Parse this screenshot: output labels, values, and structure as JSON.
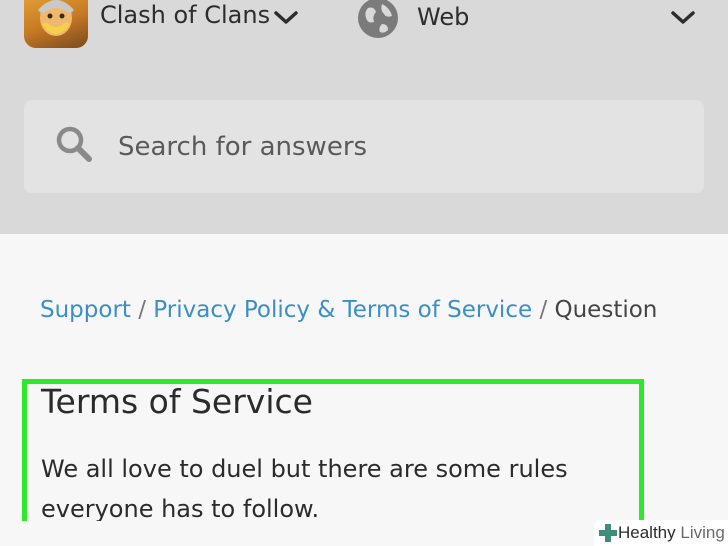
{
  "header": {
    "app_name": "Clash of Clans",
    "platform": "Web"
  },
  "search": {
    "placeholder": "Search for answers"
  },
  "breadcrumb": {
    "items": [
      "Support",
      "Privacy Policy & Terms of Service",
      "Question"
    ],
    "separator": "/"
  },
  "article": {
    "title": "Terms of Service",
    "body": "We all love to duel but there are some rules everyone has to follow."
  },
  "watermark": {
    "brand_bold": "Healthy",
    "brand_light": " Living"
  },
  "colors": {
    "header_bg": "#d9d9d9",
    "link": "#3b8fc6",
    "highlight": "#2ee82a"
  },
  "icons": [
    "app-icon",
    "chevron-down-icon",
    "globe-icon",
    "search-icon",
    "cross-icon"
  ]
}
